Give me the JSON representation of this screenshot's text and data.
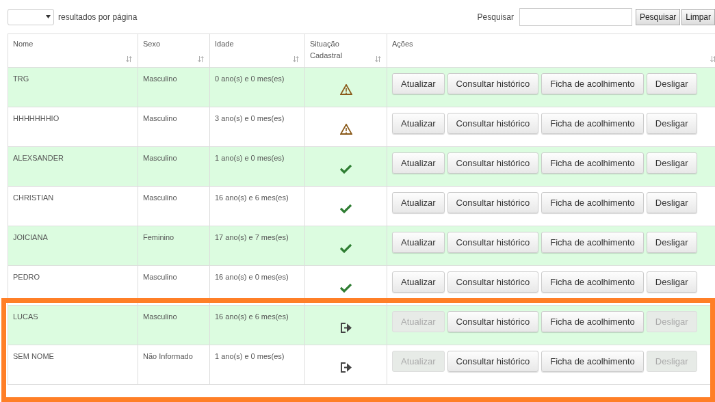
{
  "length_menu": {
    "label": "resultados por página"
  },
  "search": {
    "label": "Pesquisar",
    "buttons": [
      "Pesquisar",
      "Limpar"
    ]
  },
  "table": {
    "columns": [
      {
        "label": "Nome",
        "sortable": true
      },
      {
        "label": "Sexo",
        "sortable": true
      },
      {
        "label": "Idade",
        "sortable": true
      },
      {
        "label": "Situação Cadastral",
        "sortable": true
      },
      {
        "label": "Ações",
        "sortable": true
      }
    ],
    "rows": [
      {
        "name": "TRG",
        "sex": "Masculino",
        "age": "0 ano(s) e 0 mes(es)",
        "status": {
          "kind": "warning"
        },
        "highlighted": false,
        "actions": [
          {
            "label": "Atualizar",
            "disabled": false
          },
          {
            "label": "Consultar histórico",
            "disabled": false
          },
          {
            "label": "Ficha de acolhimento",
            "disabled": false
          },
          {
            "label": "Desligar",
            "disabled": false
          }
        ]
      },
      {
        "name": "HHHHHHHIO",
        "sex": "Masculino",
        "age": "3 ano(s) e 0 mes(es)",
        "status": {
          "kind": "warning"
        },
        "highlighted": false,
        "actions": [
          {
            "label": "Atualizar",
            "disabled": false
          },
          {
            "label": "Consultar histórico",
            "disabled": false
          },
          {
            "label": "Ficha de acolhimento",
            "disabled": false
          },
          {
            "label": "Desligar",
            "disabled": false
          }
        ]
      },
      {
        "name": "ALEXSANDER",
        "sex": "Masculino",
        "age": "1 ano(s) e 0 mes(es)",
        "status": {
          "kind": "ok"
        },
        "highlighted": false,
        "actions": [
          {
            "label": "Atualizar",
            "disabled": false
          },
          {
            "label": "Consultar histórico",
            "disabled": false
          },
          {
            "label": "Ficha de acolhimento",
            "disabled": false
          },
          {
            "label": "Desligar",
            "disabled": false
          }
        ]
      },
      {
        "name": "CHRISTIAN",
        "sex": "Masculino",
        "age": "16 ano(s) e 6 mes(es)",
        "status": {
          "kind": "ok"
        },
        "highlighted": false,
        "actions": [
          {
            "label": "Atualizar",
            "disabled": false
          },
          {
            "label": "Consultar histórico",
            "disabled": false
          },
          {
            "label": "Ficha de acolhimento",
            "disabled": false
          },
          {
            "label": "Desligar",
            "disabled": false
          }
        ]
      },
      {
        "name": "JOICIANA",
        "sex": "Feminino",
        "age": "17 ano(s) e 7 mes(es)",
        "status": {
          "kind": "ok"
        },
        "highlighted": false,
        "actions": [
          {
            "label": "Atualizar",
            "disabled": false
          },
          {
            "label": "Consultar histórico",
            "disabled": false
          },
          {
            "label": "Ficha de acolhimento",
            "disabled": false
          },
          {
            "label": "Desligar",
            "disabled": false
          }
        ]
      },
      {
        "name": "PEDRO",
        "sex": "Masculino",
        "age": "16 ano(s) e 0 mes(es)",
        "status": {
          "kind": "ok"
        },
        "highlighted": false,
        "actions": [
          {
            "label": "Atualizar",
            "disabled": false
          },
          {
            "label": "Consultar histórico",
            "disabled": false
          },
          {
            "label": "Ficha de acolhimento",
            "disabled": false
          },
          {
            "label": "Desligar",
            "disabled": false
          }
        ]
      },
      {
        "name": "LUCAS",
        "sex": "Masculino",
        "age": "16 ano(s) e 6 mes(es)",
        "status": {
          "kind": "exited"
        },
        "highlighted": true,
        "actions": [
          {
            "label": "Atualizar",
            "disabled": true
          },
          {
            "label": "Consultar histórico",
            "disabled": false
          },
          {
            "label": "Ficha de acolhimento",
            "disabled": false
          },
          {
            "label": "Desligar",
            "disabled": true
          }
        ]
      },
      {
        "name": "SEM NOME",
        "sex": "Não Informado",
        "age": "1 ano(s) e 0 mes(es)",
        "status": {
          "kind": "exited"
        },
        "highlighted": true,
        "actions": [
          {
            "label": "Atualizar",
            "disabled": true
          },
          {
            "label": "Consultar histórico",
            "disabled": false
          },
          {
            "label": "Ficha de acolhimento",
            "disabled": false
          },
          {
            "label": "Desligar",
            "disabled": true
          }
        ]
      }
    ]
  }
}
